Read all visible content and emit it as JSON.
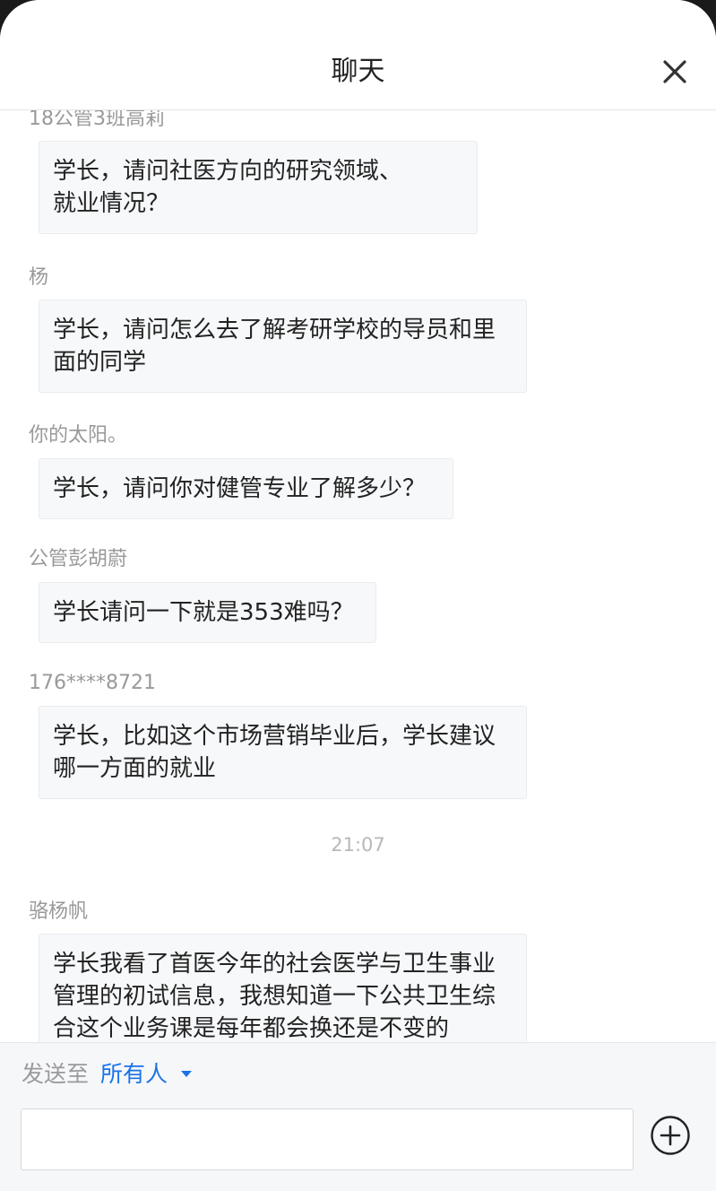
{
  "header": {
    "title": "聊天",
    "close_icon": "close-icon"
  },
  "messages": [
    {
      "sender": "18公管3班高莉",
      "text": "学长，请问社医方向的研究领域、\n就业情况？"
    },
    {
      "sender": "杨",
      "text": "学长，请问怎么去了解考研学校的导员和里\n面的同学"
    },
    {
      "sender": "你的太阳。",
      "text": "学长，请问你对健管专业了解多少？"
    },
    {
      "sender": "公管彭胡蔚",
      "text": "学长请问一下就是353难吗？"
    },
    {
      "sender": "176****8721",
      "text": "学长，比如这个市场营销毕业后，学长建议\n哪一方面的就业"
    },
    {
      "sender": "骆杨帆",
      "text": "学长我看了首医今年的社会医学与卫生事业\n管理的初试信息，我想知道一下公共卫生综\n合这个业务课是每年都会换还是不变的"
    }
  ],
  "timestamp": "21:07",
  "composer": {
    "send_to_label": "发送至",
    "recipient": "所有人",
    "input_value": "",
    "input_placeholder": "",
    "plus_icon": "plus-circle-icon"
  },
  "colors": {
    "accent": "#1a73e8",
    "bubble_bg": "#f7f8fa",
    "sender_text": "#999999"
  }
}
